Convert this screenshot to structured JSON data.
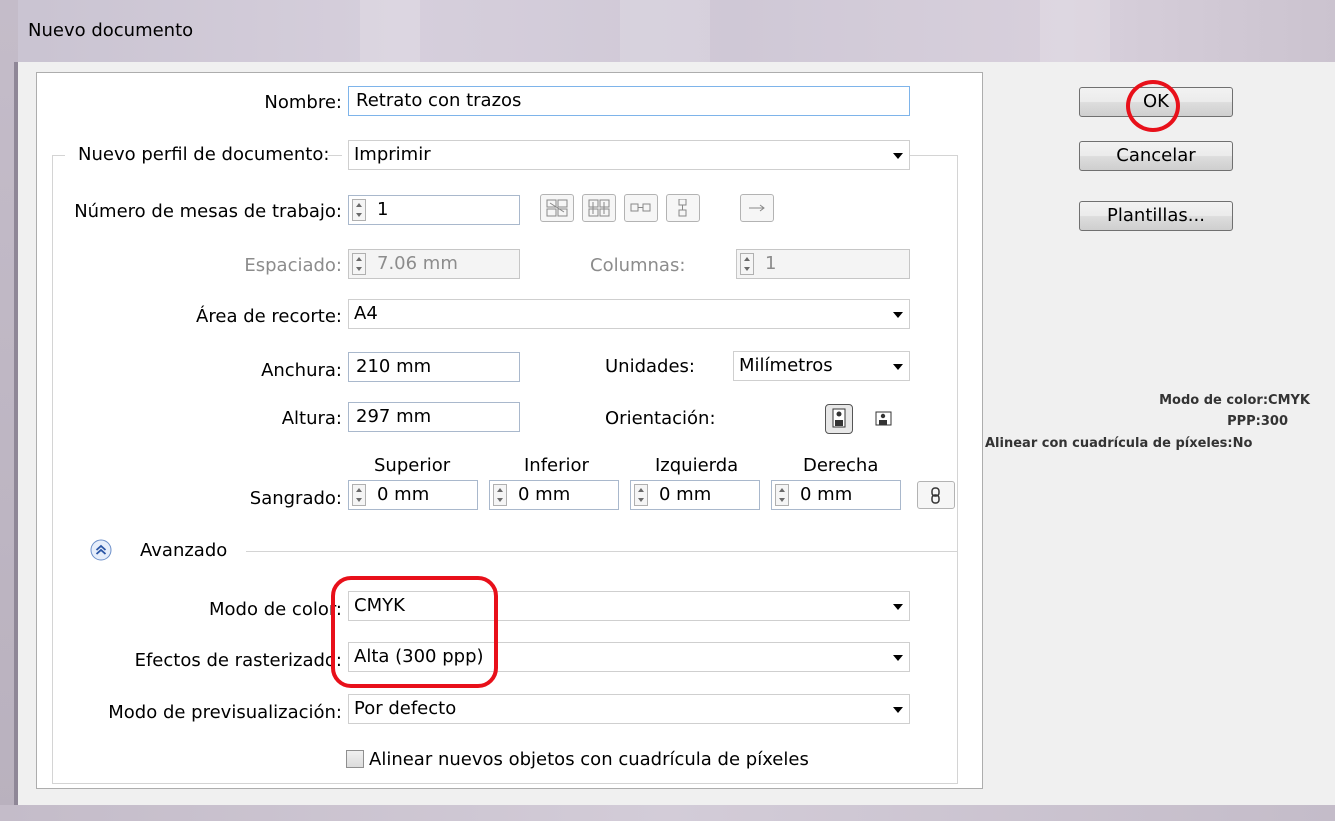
{
  "window": {
    "title": "Nuevo documento"
  },
  "fields": {
    "name_label": "Nombre:",
    "name_value": "Retrato con trazos",
    "profile_label": "Nuevo perfil de documento:",
    "profile_value": "Imprimir",
    "artboards_label": "Número de mesas de trabajo:",
    "artboards_value": "1",
    "spacing_label": "Espaciado:",
    "spacing_value": "7.06 mm",
    "columns_label": "Columnas:",
    "columns_value": "1",
    "crop_label": "Área de recorte:",
    "crop_value": "A4",
    "width_label": "Anchura:",
    "width_value": "210 mm",
    "units_label": "Unidades:",
    "units_value": "Milímetros",
    "height_label": "Altura:",
    "height_value": "297 mm",
    "orientation_label": "Orientación:",
    "bleed_label": "Sangrado:",
    "bleed_top_label": "Superior",
    "bleed_top_value": "0 mm",
    "bleed_bottom_label": "Inferior",
    "bleed_bottom_value": "0 mm",
    "bleed_left_label": "Izquierda",
    "bleed_left_value": "0 mm",
    "bleed_right_label": "Derecha",
    "bleed_right_value": "0 mm"
  },
  "advanced": {
    "label": "Avanzado",
    "color_mode_label": "Modo de color:",
    "color_mode_value": "CMYK",
    "raster_label": "Efectos de rasterizado:",
    "raster_value": "Alta (300 ppp)",
    "preview_label": "Modo de previsualización:",
    "preview_value": "Por defecto",
    "align_pixels_label": "Alinear nuevos objetos con cuadrícula de píxeles",
    "align_pixels_checked": false
  },
  "buttons": {
    "ok": "OK",
    "cancel": "Cancelar",
    "templates": "Plantillas..."
  },
  "info": {
    "line1": "Modo de color:CMYK",
    "line2": "PPP:300",
    "line3": "Alinear con cuadrícula de píxeles:No"
  },
  "colors": {
    "highlight": "#e8101a"
  }
}
